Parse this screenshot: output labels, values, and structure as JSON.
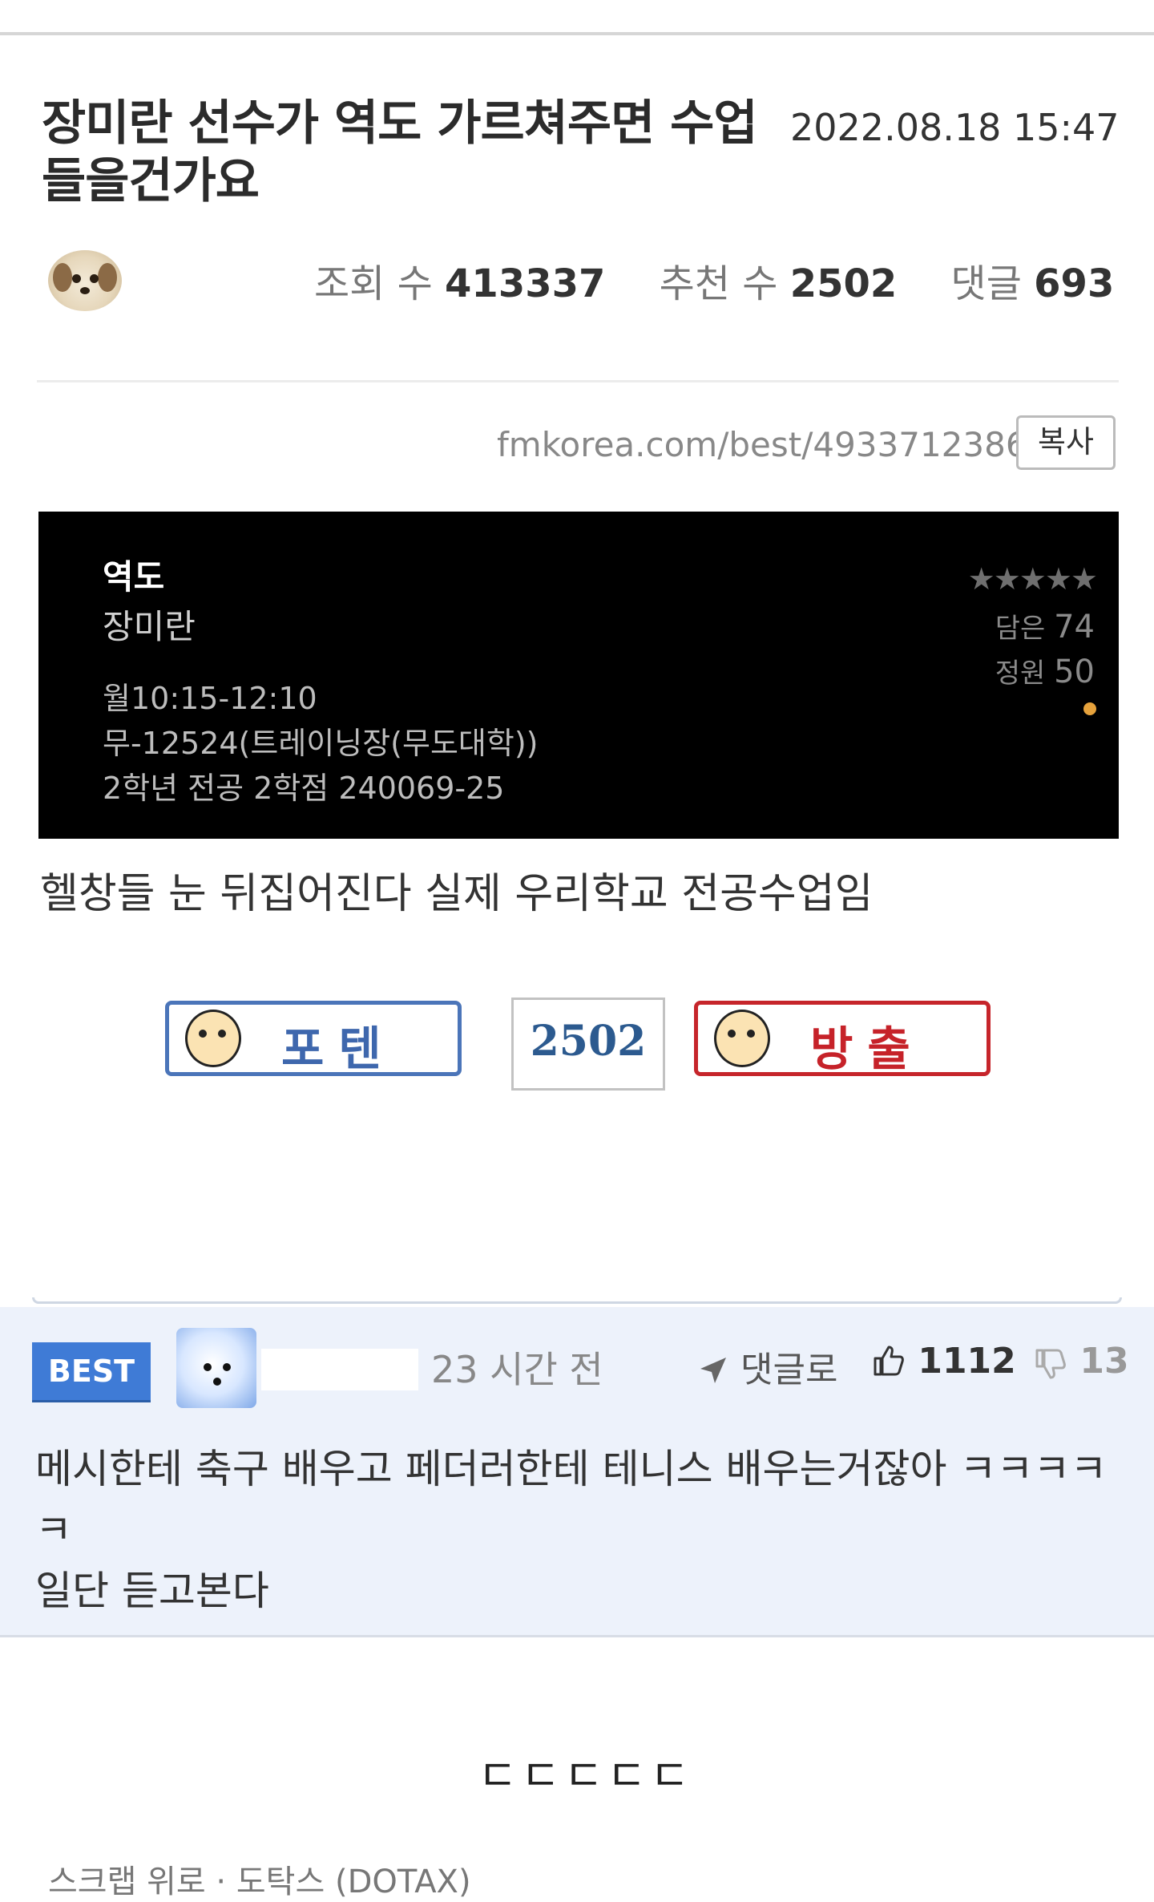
{
  "post": {
    "title": "장미란 선수가 역도 가르쳐주면 수업 들을건가요",
    "date": "2022.08.18 15:47",
    "stats": {
      "views_label": "조회 수",
      "views": "413337",
      "recommend_label": "추천 수",
      "recommend": "2502",
      "comments_label": "댓글",
      "comments": "693"
    },
    "url": "fmkorea.com/best/4933712386",
    "copy_label": "복사",
    "body_text": "헬창들 눈 뒤집어진다 실제 우리학교 전공수업임"
  },
  "course_card": {
    "subject": "역도",
    "professor": "장미란",
    "time": "월10:15-12:10",
    "room": "무-12524(트레이닝장(무도대학))",
    "info": "2학년   전공   2학점   240069-25",
    "stars": "★★★★★",
    "saved_label": "담은",
    "saved": "74",
    "capacity_label": "정원",
    "capacity": "50"
  },
  "vote": {
    "up_label": "포텐",
    "count": "2502",
    "down_label": "방출"
  },
  "best_comment": {
    "badge": "BEST",
    "time": "23 시간 전",
    "reply_label": "댓글로",
    "likes": "1112",
    "dislikes": "13",
    "text_line1": "메시한테 축구 배우고 페더러한테 테니스 배우는거잖아 ㅋㅋㅋㅋㅋ",
    "text_line2": "일단 듣고본다"
  },
  "next_comment_text": "ㄷㄷㄷㄷㄷ",
  "footer_cut_text": "스크랩 위로 · 도탁스 (DOTAX)"
}
